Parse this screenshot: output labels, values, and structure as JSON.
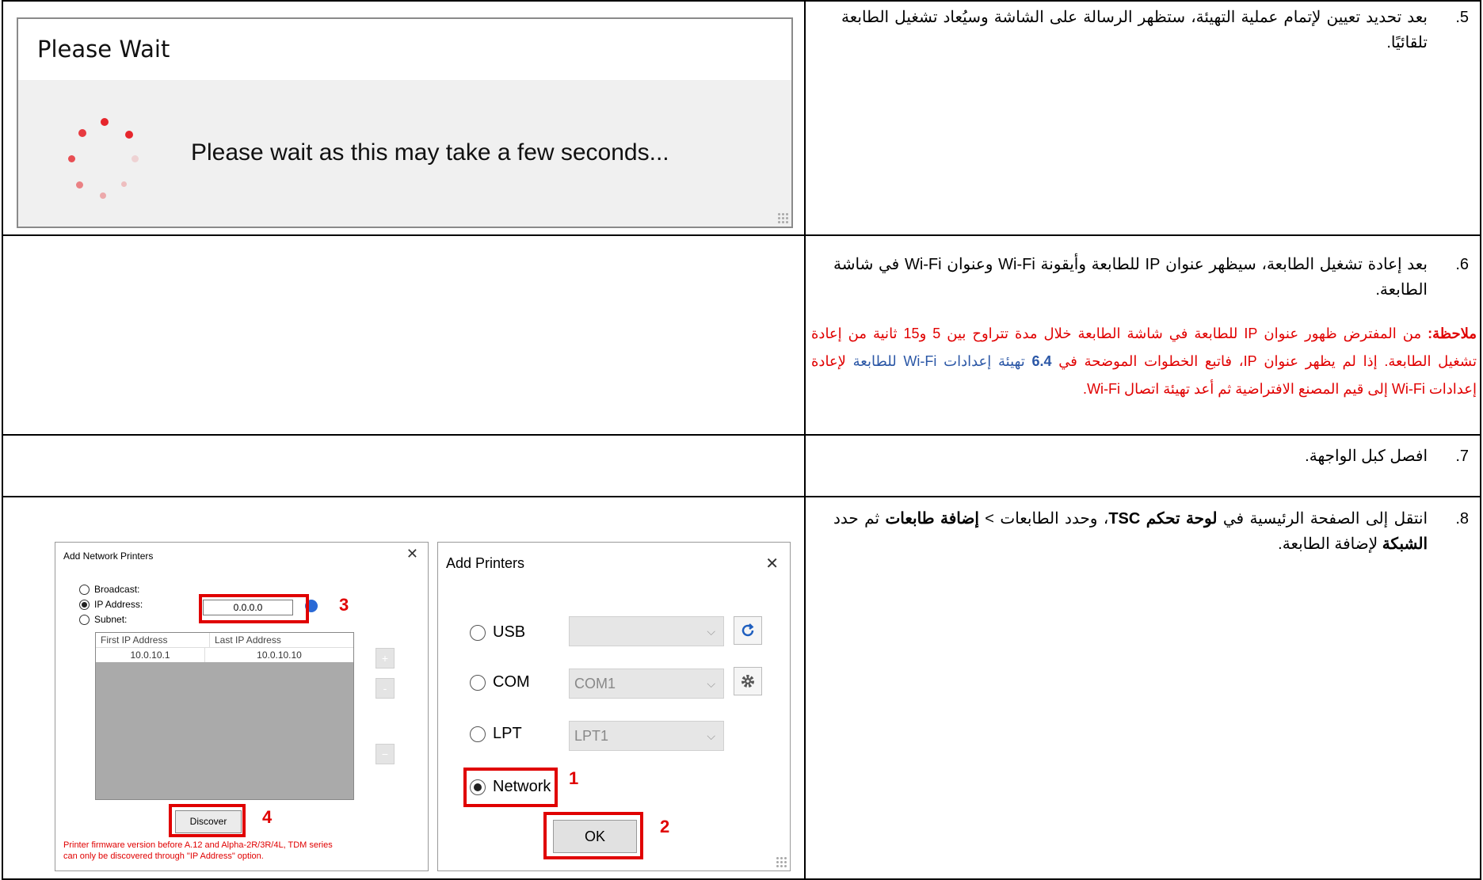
{
  "steps": [
    {
      "number": ".5",
      "text": "بعد تحديد تعيين لإتمام عملية التهيئة، ستظهر الرسالة على الشاشة وسيُعاد تشغيل الطابعة تلقائيًا."
    },
    {
      "number": ".6",
      "text": "بعد إعادة تشغيل الطابعة، سيظهر عنوان IP للطابعة وأيقونة Wi-Fi وعنوان Wi-Fi في شاشة الطابعة."
    },
    {
      "number": ".7",
      "text": "افصل كبل الواجهة."
    },
    {
      "number": ".8",
      "text_a": "انتقل إلى الصفحة الرئيسية في ",
      "bold_a": "لوحة تحكم TSC",
      "text_b": "، وحدد الطابعات > ",
      "bold_b": "إضافة طابعات",
      "text_c": " ثم حدد ",
      "bold_c": "الشبكة",
      "text_d": " لإضافة الطابعة."
    }
  ],
  "note": {
    "label": "ملاحظة:",
    "part1": " من المفترض ظهور عنوان IP للطابعة في شاشة الطابعة خلال مدة تتراوح بين 5 و15 ثانية من إعادة تشغيل الطابعة. إذا لم يظهر عنوان IP، فاتبع الخطوات الموضحة في ",
    "section": "6.4",
    "link": " تهيئة إعدادات Wi-Fi للطابعة ",
    "part2": " لإعادة إعدادات Wi-Fi إلى قيم المصنع الافتراضية ثم أعد تهيئة اتصال Wi-Fi."
  },
  "please_wait": {
    "title": "Please Wait",
    "message": "Please wait as this may take a few seconds..."
  },
  "add_network_printers": {
    "title": "Add Network Printers",
    "close": "✕",
    "options": [
      "Broadcast:",
      "IP Address:",
      "Subnet:"
    ],
    "ip_value": "0.0.0.0",
    "table_headers": [
      "First IP Address",
      "Last IP Address"
    ],
    "table_row": [
      "10.0.10.1",
      "10.0.10.10"
    ],
    "side_buttons": [
      "+",
      "-",
      "−"
    ],
    "discover_label": "Discover",
    "warning": "Printer firmware version before A.12 and Alpha-2R/3R/4L, TDM series can only be discovered through \"IP Address\" option."
  },
  "add_printers": {
    "title": "Add Printers",
    "close": "✕",
    "options": [
      {
        "label": "USB",
        "combo": ""
      },
      {
        "label": "COM",
        "combo": "COM1"
      },
      {
        "label": "LPT",
        "combo": "LPT1"
      },
      {
        "label": "Network",
        "combo": ""
      }
    ],
    "ok_label": "OK"
  },
  "callouts": [
    "1",
    "2",
    "3",
    "4"
  ],
  "colors": {
    "accent_red": "#e00000",
    "link_blue": "#2b57a6",
    "spinner_red": "#e6262c"
  },
  "icons": [
    "refresh-icon",
    "gear-icon",
    "chevron-down-icon",
    "close-icon",
    "spinner-icon",
    "info-icon"
  ]
}
